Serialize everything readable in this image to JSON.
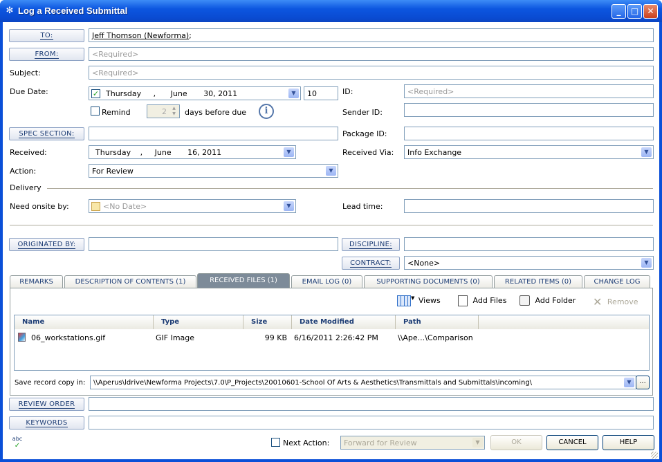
{
  "window": {
    "title": "Log a Received Submittal",
    "minimize": "_",
    "maximize": "□",
    "close": "✕"
  },
  "form": {
    "to": {
      "label": "TO:",
      "value": "Jeff Thomson (Newforma);",
      "link": "Jeff Thomson (Newforma)"
    },
    "from": {
      "label": "FROM:",
      "placeholder": "<Required>"
    },
    "subject": {
      "label": "Subject:",
      "placeholder": "<Required>"
    },
    "due_date": {
      "label": "Due Date:",
      "checked": true,
      "weekday": "Thursday",
      "sep": ",",
      "month": "June",
      "day_year": "30, 2011",
      "days": "10"
    },
    "remind": {
      "label": "Remind",
      "checked": false,
      "value": "2",
      "suffix": "days before due"
    },
    "id": {
      "label": "ID:",
      "placeholder": "<Required>"
    },
    "sender_id": {
      "label": "Sender ID:",
      "value": ""
    },
    "spec_section": {
      "label": "SPEC SECTION:",
      "value": ""
    },
    "package_id": {
      "label": "Package ID:",
      "value": ""
    },
    "received": {
      "label": "Received:",
      "weekday": "Thursday",
      "sep": ",",
      "month": "June",
      "day_year": "16, 2011"
    },
    "received_via": {
      "label": "Received Via:",
      "value": "Info Exchange"
    },
    "action": {
      "label": "Action:",
      "value": "For Review"
    },
    "delivery": {
      "label": "Delivery"
    },
    "need_onsite": {
      "label": "Need onsite by:",
      "placeholder": "<No Date>"
    },
    "lead_time": {
      "label": "Lead time:",
      "value": ""
    },
    "originated_by": {
      "label": "ORIGINATED BY:",
      "value": ""
    },
    "discipline": {
      "label": "DISCIPLINE:",
      "value": ""
    },
    "contract": {
      "label": "CONTRACT:",
      "value": "<None>"
    }
  },
  "tabs": [
    {
      "label": "REMARKS"
    },
    {
      "label": "DESCRIPTION OF CONTENTS (1)"
    },
    {
      "label": "RECEIVED FILES (1)"
    },
    {
      "label": "EMAIL LOG (0)"
    },
    {
      "label": "SUPPORTING DOCUMENTS (0)"
    },
    {
      "label": "RELATED ITEMS (0)"
    },
    {
      "label": "CHANGE LOG"
    }
  ],
  "toolbar": {
    "views": "Views",
    "add_files": "Add Files",
    "add_folder": "Add Folder",
    "remove": "Remove"
  },
  "files": {
    "columns": [
      "Name",
      "Type",
      "Size",
      "Date Modified",
      "Path"
    ],
    "rows": [
      {
        "name": "06_workstations.gif",
        "type": "GIF Image",
        "size": "99 KB",
        "modified": "6/16/2011 2:26:42 PM",
        "path": "\\\\Ape...\\Comparison"
      }
    ]
  },
  "save_copy": {
    "label": "Save record copy in:",
    "value": "\\\\Aperus\\ldrive\\Newforma Projects\\7.0\\P_Projects\\20010601-School Of Arts & Aesthetics\\Transmittals and Submittals\\incoming\\",
    "browse": "..."
  },
  "review_order": {
    "label": "REVIEW ORDER",
    "value": ""
  },
  "keywords": {
    "label": "KEYWORDS",
    "value": ""
  },
  "footer": {
    "spell_icon": "abc",
    "next_action_label": "Next Action:",
    "next_action_checked": false,
    "next_action_value": "Forward for Review",
    "ok": "OK",
    "cancel": "CANCEL",
    "help": "HELP"
  }
}
